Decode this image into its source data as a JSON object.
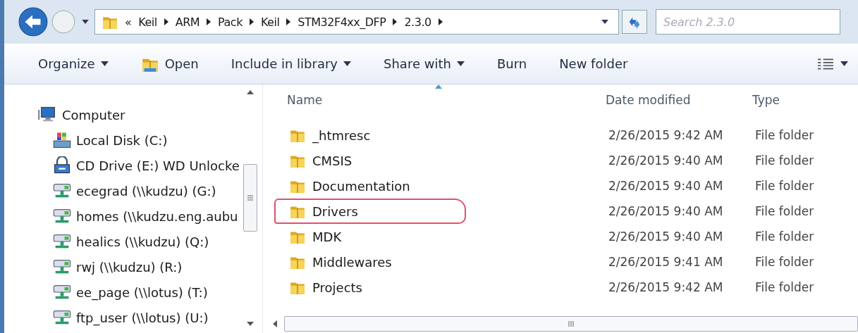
{
  "address_bar": {
    "overflow": "«",
    "crumbs": [
      "Keil",
      "ARM",
      "Pack",
      "Keil",
      "STM32F4xx_DFP",
      "2.3.0"
    ]
  },
  "search": {
    "placeholder": "Search 2.3.0"
  },
  "toolbar": [
    {
      "label": "Organize",
      "kind": "menu"
    },
    {
      "label": "Open",
      "kind": "open"
    },
    {
      "label": "Include in library",
      "kind": "menu"
    },
    {
      "label": "Share with",
      "kind": "menu"
    },
    {
      "label": "Burn",
      "kind": "plain"
    },
    {
      "label": "New folder",
      "kind": "plain"
    }
  ],
  "navigation_pane": {
    "tree": [
      {
        "label": "Computer",
        "kind": "computer",
        "children": [
          {
            "label": "Local Disk (C:)",
            "kind": "local_disk"
          },
          {
            "label": "CD Drive (E:) WD Unlocke",
            "kind": "cd_drive"
          },
          {
            "label": "ecegrad (\\\\kudzu) (G:)",
            "kind": "network_drive"
          },
          {
            "label": "homes (\\\\kudzu.eng.aubu",
            "kind": "network_drive"
          },
          {
            "label": "healics (\\\\kudzu) (Q:)",
            "kind": "network_drive"
          },
          {
            "label": "rwj (\\\\kudzu) (R:)",
            "kind": "network_drive"
          },
          {
            "label": "ee_page (\\\\lotus) (T:)",
            "kind": "network_drive"
          },
          {
            "label": "ftp_user (\\\\lotus) (U:)",
            "kind": "network_drive"
          }
        ]
      }
    ]
  },
  "file_list": {
    "columns": [
      {
        "label": "Name",
        "sorted": true
      },
      {
        "label": "Date modified",
        "sorted": false
      },
      {
        "label": "Type",
        "sorted": false
      }
    ],
    "rows": [
      {
        "name": "_htmresc",
        "date": "2/26/2015 9:42 AM",
        "type": "File folder",
        "circled": false
      },
      {
        "name": "CMSIS",
        "date": "2/26/2015 9:40 AM",
        "type": "File folder",
        "circled": false
      },
      {
        "name": "Documentation",
        "date": "2/26/2015 9:40 AM",
        "type": "File folder",
        "circled": false
      },
      {
        "name": "Drivers",
        "date": "2/26/2015 9:40 AM",
        "type": "File folder",
        "circled": true
      },
      {
        "name": "MDK",
        "date": "2/26/2015 9:40 AM",
        "type": "File folder",
        "circled": false
      },
      {
        "name": "Middlewares",
        "date": "2/26/2015 9:41 AM",
        "type": "File folder",
        "circled": false
      },
      {
        "name": "Projects",
        "date": "2/26/2015 9:42 AM",
        "type": "File folder",
        "circled": false
      }
    ]
  }
}
